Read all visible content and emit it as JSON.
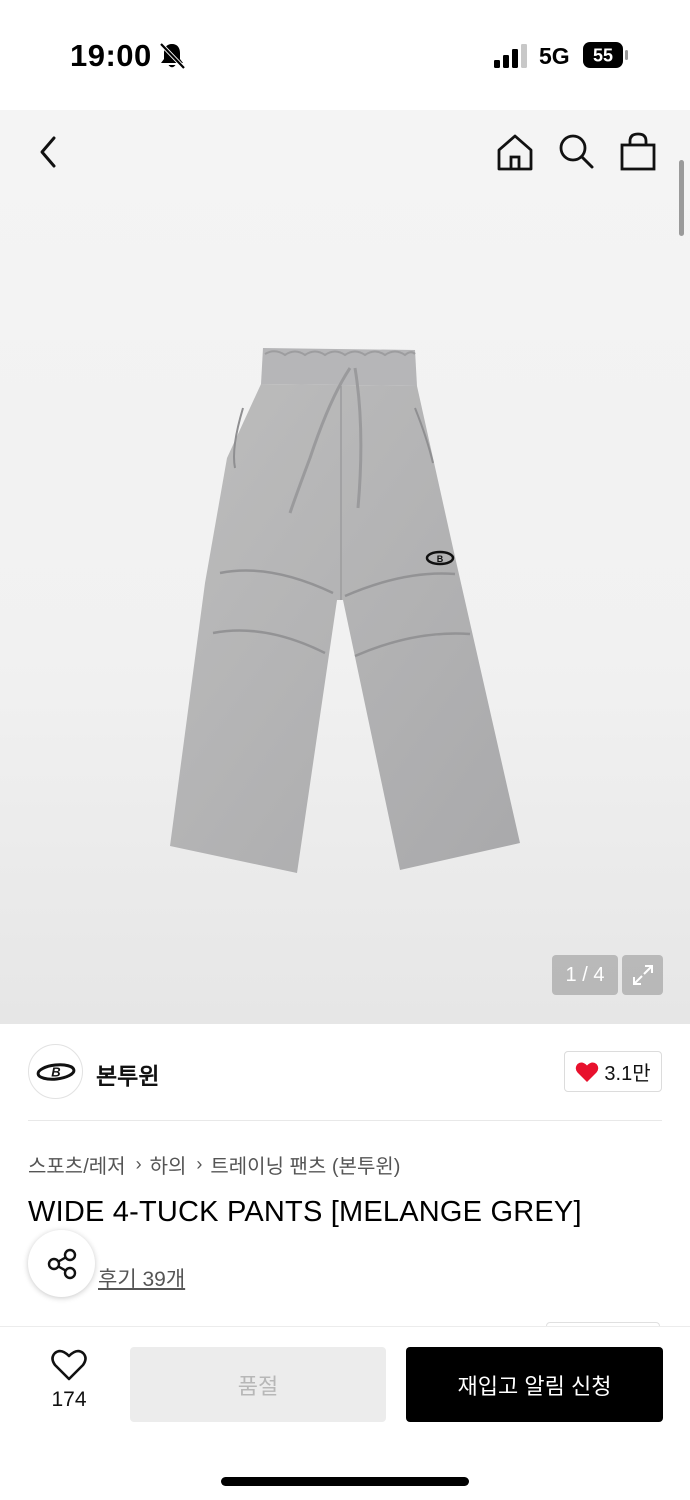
{
  "status_bar": {
    "time": "19:00",
    "network": "5G",
    "battery": "55"
  },
  "nav": {
    "icons": [
      "back-arrow-icon",
      "home-icon",
      "search-icon",
      "shopping-bag-icon"
    ]
  },
  "gallery": {
    "pager": "1 / 4",
    "icons": [
      "expand-icon"
    ]
  },
  "brand": {
    "name": "본투윈",
    "likes": "3.1만",
    "logo_text": "B"
  },
  "breadcrumb": [
    "스포츠/레저",
    "하의",
    "트레이닝 팬츠 (본투윈)"
  ],
  "product": {
    "title": "WIDE 4-TUCK PANTS [MELANGE GREY]",
    "reviews": "후기 39개"
  },
  "bottom_bar": {
    "wish_count": "174",
    "soldout_label": "품절",
    "restock_label": "재입고 알림 신청"
  },
  "colors": {
    "accent_heart": "#e8112d",
    "primary_button": "#000000",
    "disabled_button": "#ececec"
  }
}
